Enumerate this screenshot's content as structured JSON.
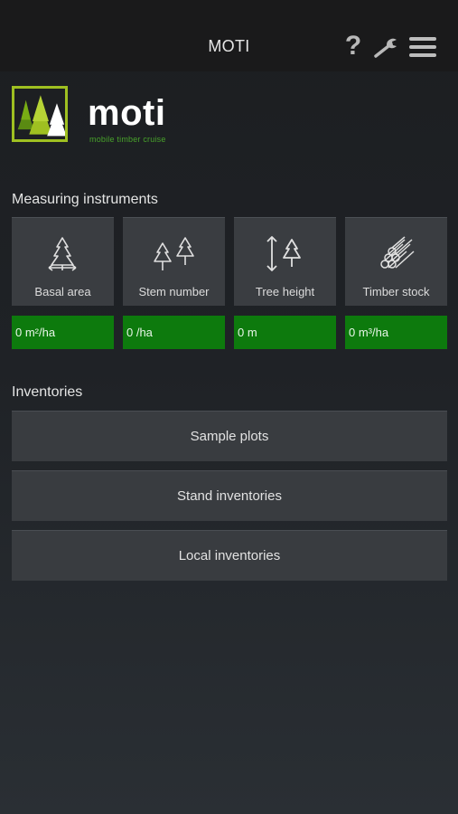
{
  "header": {
    "title": "MOTI",
    "help_icon": "?"
  },
  "logo": {
    "word": "moti",
    "tagline": "mobile timber cruise"
  },
  "measuring": {
    "title": "Measuring instruments",
    "items": [
      {
        "label": "Basal area",
        "value": "0 m²/ha",
        "icon": "tree-basal-icon"
      },
      {
        "label": "Stem number",
        "value": "0 /ha",
        "icon": "two-trees-icon"
      },
      {
        "label": "Tree height",
        "value": "0 m",
        "icon": "tree-height-icon"
      },
      {
        "label": "Timber stock",
        "value": "0 m³/ha",
        "icon": "log-pile-icon"
      }
    ]
  },
  "inventories": {
    "title": "Inventories",
    "buttons": [
      "Sample plots",
      "Stand inventories",
      "Local inventories"
    ]
  },
  "colors": {
    "value_green": "#0d7a0d",
    "logo_green": "#9fc021",
    "tile": "#3a3d41"
  }
}
